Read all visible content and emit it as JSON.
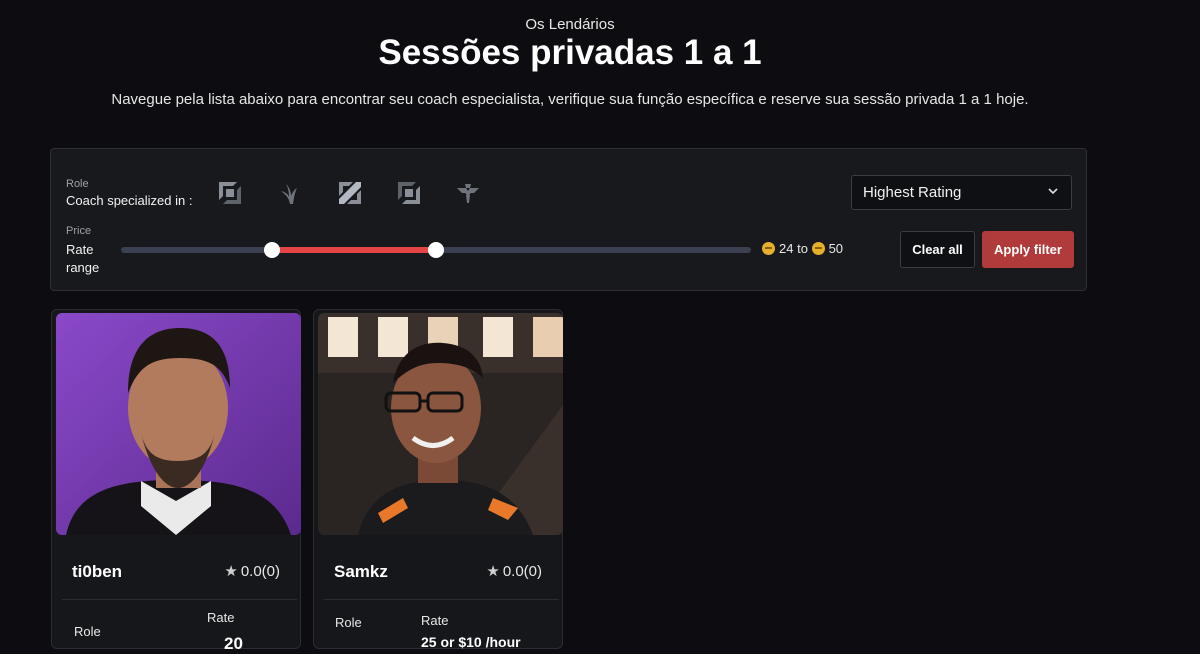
{
  "header": {
    "brand": "Os Lendários",
    "title": "Sessões privadas 1 a 1",
    "subtitle": "Navegue pela lista abaixo para encontrar seu coach especialista, verifique sua função específica e reserve sua sessão privada 1 a 1 hoje."
  },
  "filter": {
    "role_label_small": "Role",
    "role_label_main": "Coach specialized in :",
    "roles": [
      "top-lane-icon",
      "jungle-icon",
      "mid-lane-icon",
      "bot-lane-icon",
      "support-icon"
    ],
    "price_label_small": "Price",
    "price_label_main_1": "Rate",
    "price_label_main_2": "range",
    "range_min": "24",
    "range_to": "to",
    "range_max": "50",
    "slider_low_fraction": 0.24,
    "slider_high_fraction": 0.5,
    "sort_selected": "Highest Rating",
    "clear_label": "Clear all",
    "apply_label": "Apply filter",
    "accent_color": "#e44646",
    "apply_color": "#b13a3a"
  },
  "coaches": [
    {
      "name": "ti0ben",
      "rating": "0.0(0)",
      "role_label": "Role",
      "rate_label": "Rate",
      "rate_value": "20"
    },
    {
      "name": "Samkz",
      "rating": "0.0(0)",
      "role_label": "Role",
      "rate_label": "Rate",
      "rate_value": "25 or $10 /hour"
    }
  ]
}
